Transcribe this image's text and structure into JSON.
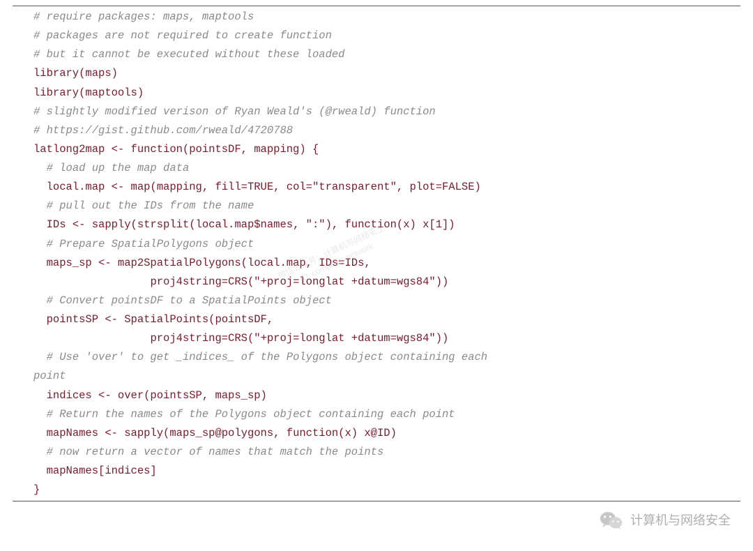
{
  "code": {
    "lines": [
      {
        "indent": 0,
        "parts": [
          {
            "cls": "c",
            "t": "# require packages: maps, maptools"
          }
        ]
      },
      {
        "indent": 0,
        "parts": [
          {
            "cls": "c",
            "t": "# packages are not required to create function"
          }
        ]
      },
      {
        "indent": 0,
        "parts": [
          {
            "cls": "c",
            "t": "# but it cannot be executed without these loaded"
          }
        ]
      },
      {
        "indent": 0,
        "parts": [
          {
            "cls": "kw",
            "t": "library(maps)"
          }
        ]
      },
      {
        "indent": 0,
        "parts": [
          {
            "cls": "kw",
            "t": "library(maptools)"
          }
        ]
      },
      {
        "indent": 0,
        "parts": [
          {
            "cls": "c",
            "t": "# slightly modified verison of Ryan Weald's (@rweald) function"
          }
        ]
      },
      {
        "indent": 0,
        "parts": [
          {
            "cls": "c",
            "t": "# https://gist.github.com/rweald/4720788"
          }
        ]
      },
      {
        "indent": 0,
        "parts": [
          {
            "cls": "kw",
            "t": "latlong2map <- function(pointsDF, mapping) {"
          }
        ]
      },
      {
        "indent": 1,
        "parts": [
          {
            "cls": "c",
            "t": "# load up the map data"
          }
        ]
      },
      {
        "indent": 1,
        "parts": [
          {
            "cls": "kw",
            "t": "local.map <- map(mapping, fill=TRUE, col=\"transparent\", plot=FALSE)"
          }
        ]
      },
      {
        "indent": 1,
        "parts": [
          {
            "cls": "c",
            "t": "# pull out the IDs from the name"
          }
        ]
      },
      {
        "indent": 1,
        "parts": [
          {
            "cls": "kw",
            "t": "IDs <- sapply(strsplit(local.map$names, \":\"), function(x) x[1])"
          }
        ]
      },
      {
        "indent": 1,
        "parts": [
          {
            "cls": "c",
            "t": "# Prepare SpatialPolygons object"
          }
        ]
      },
      {
        "indent": 1,
        "parts": [
          {
            "cls": "kw",
            "t": "maps_sp <- map2SpatialPolygons(local.map, IDs=IDs,"
          }
        ]
      },
      {
        "indent": 5,
        "parts": [
          {
            "cls": "kw",
            "t": "proj4string=CRS(\"+proj=longlat +datum=wgs84\"))"
          }
        ]
      },
      {
        "indent": 1,
        "parts": [
          {
            "cls": "c",
            "t": "# Convert pointsDF to a SpatialPoints object"
          }
        ]
      },
      {
        "indent": 1,
        "parts": [
          {
            "cls": "kw",
            "t": "pointsSP <- SpatialPoints(pointsDF,"
          }
        ]
      },
      {
        "indent": 5,
        "parts": [
          {
            "cls": "kw",
            "t": "proj4string=CRS(\"+proj=longlat +datum=wgs84\"))"
          }
        ]
      },
      {
        "indent": 1,
        "parts": [
          {
            "cls": "c",
            "t": "# Use 'over' to get _indices_ of the Polygons object containing each"
          }
        ]
      },
      {
        "indent": 0,
        "parts": [
          {
            "cls": "c",
            "t": "point"
          }
        ]
      },
      {
        "indent": 1,
        "parts": [
          {
            "cls": "kw",
            "t": "indices <- over(pointsSP, maps_sp)"
          }
        ]
      },
      {
        "indent": 1,
        "parts": [
          {
            "cls": "c",
            "t": "# Return the names of the Polygons object containing each point"
          }
        ]
      },
      {
        "indent": 1,
        "parts": [
          {
            "cls": "kw",
            "t": "mapNames <- sapply(maps_sp@polygons, function(x) x@ID)"
          }
        ]
      },
      {
        "indent": 1,
        "parts": [
          {
            "cls": "c",
            "t": "# now return a vector of names that match the points"
          }
        ]
      },
      {
        "indent": 1,
        "parts": [
          {
            "cls": "kw",
            "t": "mapNames[indices]"
          }
        ]
      },
      {
        "indent": 0,
        "parts": [
          {
            "cls": "kw",
            "t": "}"
          }
        ]
      }
    ]
  },
  "watermark_center": {
    "line1": "微信公众号：计算机与网络安全",
    "line2": "ID: computer-network"
  },
  "watermark_bottom": "计算机与网络安全"
}
